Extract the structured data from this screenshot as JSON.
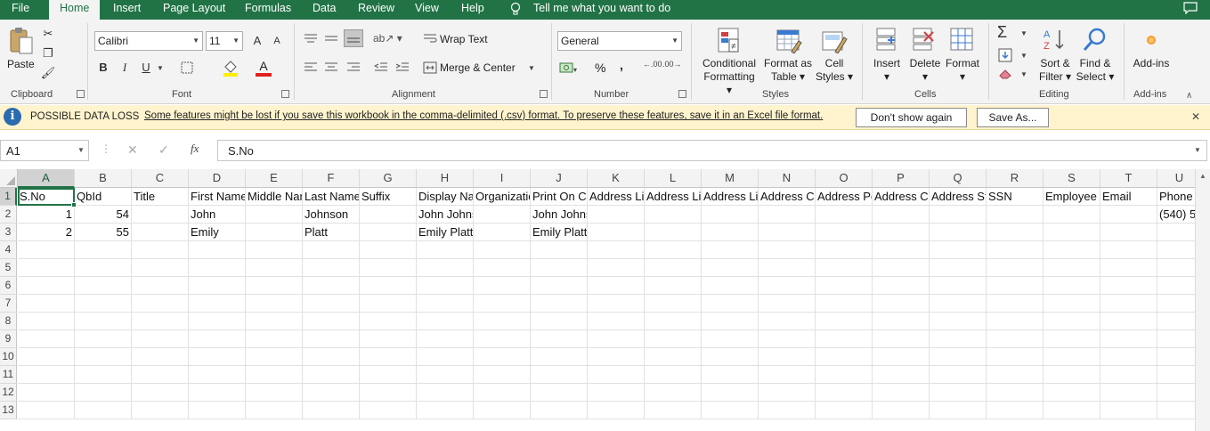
{
  "menu": {
    "tabs": [
      "File",
      "Home",
      "Insert",
      "Page Layout",
      "Formulas",
      "Data",
      "Review",
      "View",
      "Help"
    ],
    "active_tab": "Home",
    "tell_me": "Tell me what you want to do"
  },
  "ribbon": {
    "clipboard": {
      "paste": "Paste",
      "label": "Clipboard"
    },
    "font": {
      "name": "Calibri",
      "size": "11",
      "label": "Font",
      "bold": "B",
      "italic": "I",
      "underline": "U",
      "grow": "A",
      "shrink": "A",
      "font_color_letter": "A"
    },
    "alignment": {
      "wrap_text": "Wrap Text",
      "merge_center": "Merge & Center",
      "label": "Alignment"
    },
    "number": {
      "format": "General",
      "percent": "%",
      "comma": ",",
      "inc_decimal": "←.00",
      "dec_decimal": ".00→",
      "label": "Number"
    },
    "styles": {
      "conditional_1": "Conditional",
      "conditional_2": "Formatting",
      "format_table_1": "Format as",
      "format_table_2": "Table",
      "cell_styles_1": "Cell",
      "cell_styles_2": "Styles",
      "label": "Styles"
    },
    "cells": {
      "insert": "Insert",
      "delete": "Delete",
      "format": "Format",
      "label": "Cells"
    },
    "editing": {
      "sort_1": "Sort &",
      "sort_2": "Filter",
      "find_1": "Find &",
      "find_2": "Select",
      "label": "Editing",
      "sigma": "Σ"
    },
    "addins": {
      "addins": "Add-ins",
      "label": "Add-ins"
    }
  },
  "notification": {
    "title": "POSSIBLE DATA LOSS",
    "message": "Some features might be lost if you save this workbook in the comma-delimited (.csv) format. To preserve these features, save it in an Excel file format.",
    "dont_show": "Don't show again",
    "save_as": "Save As...",
    "info_glyph": "i",
    "close_glyph": "✕"
  },
  "formula_bar": {
    "name_box": "A1",
    "fx": "fx",
    "cancel_glyph": "✕",
    "enter_glyph": "✓",
    "value": "S.No"
  },
  "sheet": {
    "columns": [
      "A",
      "B",
      "C",
      "D",
      "E",
      "F",
      "G",
      "H",
      "I",
      "J",
      "K",
      "L",
      "M",
      "N",
      "O",
      "P",
      "Q",
      "R",
      "S",
      "T",
      "U"
    ],
    "rows": [
      "1",
      "2",
      "3",
      "4",
      "5",
      "6",
      "7",
      "8",
      "9",
      "10",
      "11",
      "12",
      "13"
    ],
    "header_row": [
      "S.No",
      "QbId",
      "Title",
      "First Name",
      "Middle Name",
      "Last Name",
      "Suffix",
      "Display Name",
      "Organization",
      "Print On Check",
      "Address Line",
      "Address Line",
      "Address Line",
      "Address City",
      "Address Postal",
      "Address Country",
      "Address State",
      "SSN",
      "Employee",
      "Email",
      "Phone"
    ],
    "data_rows": [
      [
        "1",
        "54",
        "",
        "John",
        "",
        "Johnson",
        "",
        "John Johnson",
        "",
        "John Johnson",
        "",
        "",
        "",
        "",
        "",
        "",
        "",
        "",
        "",
        "",
        "(540) 5"
      ],
      [
        "2",
        "55",
        "",
        "Emily",
        "",
        "Platt",
        "",
        "Emily Platt",
        "",
        "Emily Platt",
        "",
        "",
        "",
        "",
        "",
        "",
        "",
        "",
        "",
        "",
        ""
      ]
    ]
  },
  "colors": {
    "accent": "#217346",
    "notification_bg": "#fff4ce",
    "info_icon": "#2b6cb0",
    "font_color_bar": "#e02020",
    "highlight_bar": "#ffee00"
  }
}
